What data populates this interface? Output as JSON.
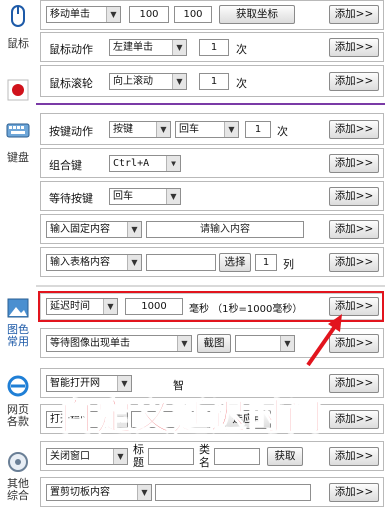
{
  "sidebar": {
    "mouse_label": "鼠标",
    "keyboard_label": "键盘",
    "image_color_label": [
      "图色",
      "常用"
    ],
    "web_label": [
      "网页",
      "各款"
    ],
    "other_label": [
      "其他",
      "综合"
    ]
  },
  "rows": {
    "move_click": {
      "action": "移动单击",
      "x": "100",
      "y": "100",
      "get_coords": "获取坐标",
      "add": "添加>>"
    },
    "mouse_action": {
      "label": "鼠标动作",
      "action": "左建单击",
      "count": "1",
      "unit": "次",
      "add": "添加>>"
    },
    "mouse_wheel": {
      "label": "鼠标滚轮",
      "action": "向上滚动",
      "count": "1",
      "unit": "次",
      "add": "添加>>"
    },
    "key_action": {
      "label": "按键动作",
      "action": "按键",
      "key": "回车",
      "count": "1",
      "unit": "次",
      "add": "添加>>"
    },
    "combo_key": {
      "label": "组合键",
      "value": "Ctrl+A",
      "add": "添加>>"
    },
    "wait_key": {
      "label": "等待按键",
      "value": "回车",
      "add": "添加>>"
    },
    "input_fixed": {
      "action": "输入固定内容",
      "placeholder": "请输入内容",
      "add": "添加>>"
    },
    "input_table": {
      "action": "输入表格内容",
      "select": "选择",
      "col": "1",
      "col_unit": "列",
      "add": "添加>>"
    },
    "delay": {
      "action": "延迟时间",
      "value": "1000",
      "unit_note": "毫秒 （1秒=1000毫秒）",
      "add": "添加>>"
    },
    "wait_image": {
      "action": "等待图像出现单击",
      "screenshot": "截图",
      "add": "添加>>"
    },
    "open_page": {
      "action": "智能打开网",
      "partial": "智",
      "add": "添加>>"
    },
    "open_program": {
      "action": "打开程序",
      "choose_app": "选应用",
      "add": "添加>>"
    },
    "close_window": {
      "action": "关闭窗口",
      "title_label": "标题",
      "class_label": "类名",
      "get": "获取",
      "add": "添加>>"
    },
    "clipboard": {
      "action": "置剪切板内容",
      "add": "添加>>"
    }
  },
  "overlay_caption": "自定义延迟时间",
  "colors": {
    "accent_red": "#e2141d",
    "separator": "#7a3aa6",
    "marker": "#c8191f"
  }
}
